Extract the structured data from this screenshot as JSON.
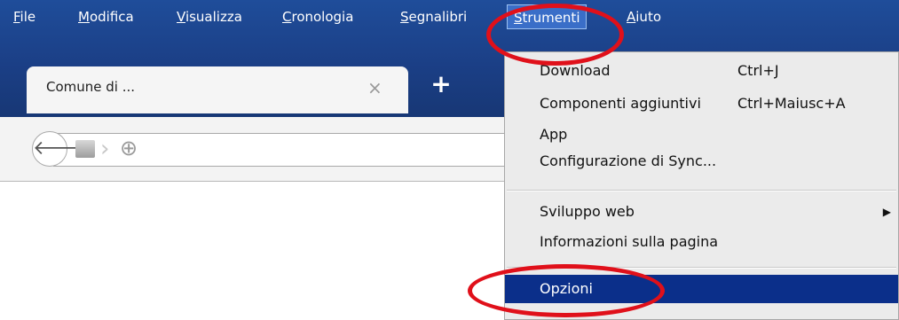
{
  "menubar": {
    "items": [
      {
        "label": "File"
      },
      {
        "label": "Modifica"
      },
      {
        "label": "Visualizza"
      },
      {
        "label": "Cronologia"
      },
      {
        "label": "Segnalibri"
      },
      {
        "label": "Strumenti"
      },
      {
        "label": "Aiuto"
      }
    ]
  },
  "tab": {
    "title": "Comune di ...",
    "close_glyph": "×"
  },
  "new_tab_glyph": "+",
  "navbar": {
    "back_glyph": "🡐",
    "globe_glyph": "⊕"
  },
  "dropdown": {
    "items": [
      {
        "label": "Download",
        "shortcut": "Ctrl+J"
      },
      {
        "label": "Componenti aggiuntivi",
        "shortcut": "Ctrl+Maiusc+A"
      },
      {
        "label": "App",
        "shortcut": ""
      },
      {
        "label": "Configurazione di Sync...",
        "shortcut": ""
      },
      {
        "label": "Sviluppo web",
        "shortcut": "",
        "submenu_glyph": "▶"
      },
      {
        "label": "Informazioni sulla pagina",
        "shortcut": ""
      },
      {
        "label": "Opzioni",
        "shortcut": ""
      }
    ]
  },
  "colors": {
    "chrome": "#1b3f86",
    "highlight": "#0b2f8a",
    "annotation": "#e0101a"
  }
}
